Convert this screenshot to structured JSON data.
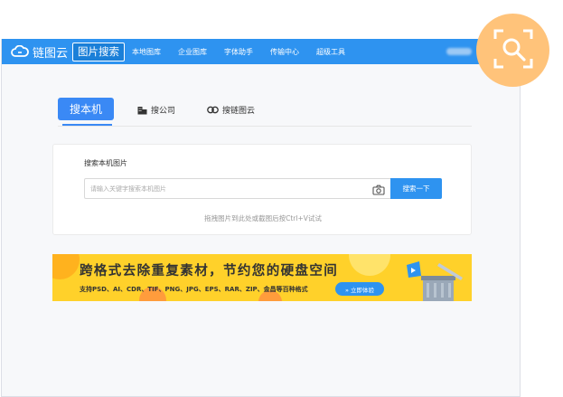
{
  "app": {
    "logo_text": "链图云",
    "active_nav": "图片搜索",
    "nav_items": [
      "本地图库",
      "企业图库",
      "字体助手",
      "传输中心",
      "超级工具"
    ],
    "window_controls": [
      "|",
      "☰",
      "—"
    ]
  },
  "tabs": {
    "active": "搜本机",
    "company": "搜公司",
    "cloud": "搜链图云"
  },
  "search": {
    "heading": "搜索本机图片",
    "placeholder": "请输入关键字搜索本机图片",
    "button": "搜索一下",
    "drag_hint": "拖拽图片到此处或截图后按Ctrl+V试试"
  },
  "banner": {
    "title": "跨格式去除重复素材，节约您的硬盘空间",
    "subtitle": "支持PSD、AI、CDR、TIF、PNG、JPG、EPS、RAR、ZIP、金昌等百种格式",
    "button": "立即体验"
  },
  "colors": {
    "brand_blue": "#2e93f0",
    "tab_blue": "#3a89f5",
    "banner_yellow": "#ffd12a",
    "badge_orange": "#ffc37a"
  },
  "icons": {
    "logo": "cloud-link-icon",
    "company": "building-icon",
    "cloud": "chain-link-icon",
    "camera": "camera-icon",
    "badge": "image-search-icon"
  }
}
